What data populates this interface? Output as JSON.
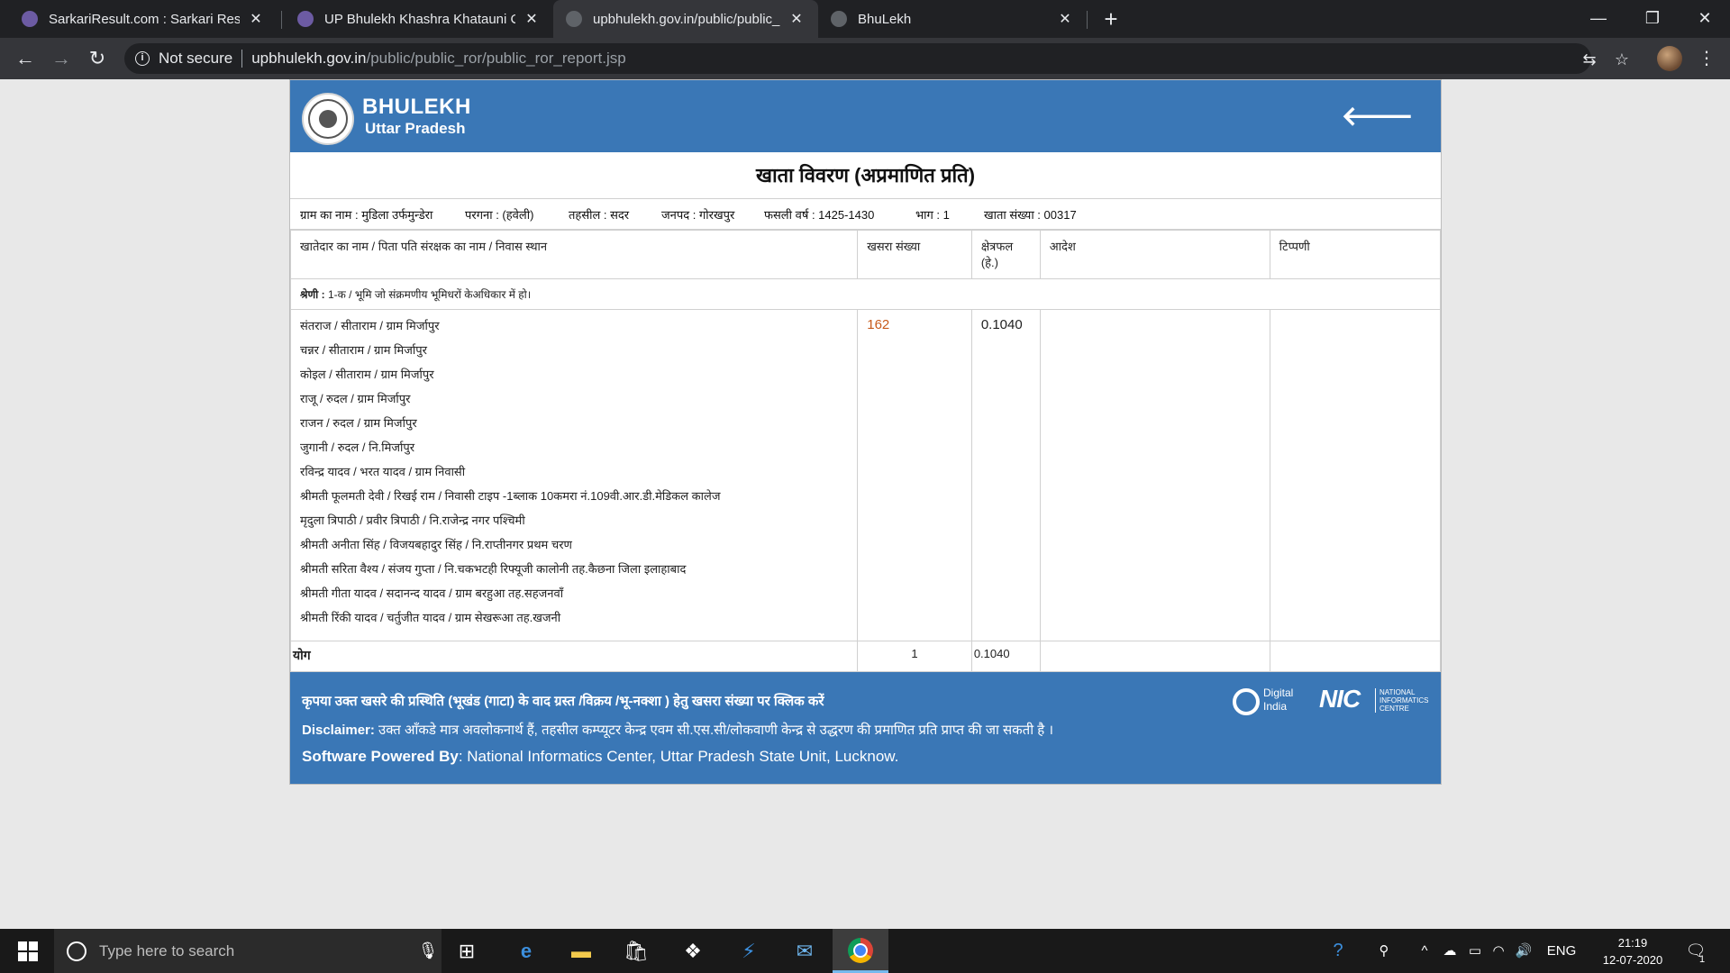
{
  "browser": {
    "tabs": [
      {
        "title": "SarkariResult.com : Sarkari Result",
        "favicon_color": "#6c5ba3",
        "active": false
      },
      {
        "title": "UP Bhulekh Khashra Khatauni Ch",
        "favicon_color": "#6c5ba3",
        "active": false
      },
      {
        "title": "upbhulekh.gov.in/public/public_r",
        "favicon_color": "#5f6368",
        "active": true
      },
      {
        "title": "BhuLekh",
        "favicon_color": "#5f6368",
        "active": false
      }
    ],
    "new_tab_icon": "+",
    "window_controls": {
      "minimize": "—",
      "maximize": "❐",
      "close": "✕"
    },
    "security_label": "Not secure",
    "url_host": "upbhulekh.gov.in",
    "url_path": "/public/public_ror/public_ror_report.jsp"
  },
  "site": {
    "brand_title": "BHULEKH",
    "brand_subtitle": "Uttar Pradesh",
    "header_color": "#3a77b6"
  },
  "report": {
    "title": "खाता विवरण (अप्रमाणित प्रति)",
    "info": {
      "village": "ग्राम का नाम : मुडिला उर्फमुन्डेरा",
      "pargana": "परगना : (हवेली)",
      "tehsil": "तहसील : सदर",
      "district": "जनपद : गोरखपुर",
      "fasli_year": "फसली वर्ष : 1425-1430",
      "bhag": "भाग : 1",
      "khata_no": "खाता संख्या : 00317"
    },
    "columns": {
      "owner": "खातेदार का नाम / पिता पति संरक्षक का नाम / निवास स्थान",
      "khasra": "खसरा संख्या",
      "area": "क्षेत्रफल",
      "area_unit": "(हे.)",
      "order": "आदेश",
      "remark": "टिप्पणी"
    },
    "category_label": "श्रेणी :",
    "category_text": " 1-क / भूमि जो संक्रमणीय भूमिधरों केअधिकार में हो।",
    "owners": [
      "संतराज / सीताराम / ग्राम मिर्जापुर",
      "चन्नर / सीताराम / ग्राम मिर्जापुर",
      "कोइल / सीताराम / ग्राम मिर्जापुर",
      "राजू / रुदल / ग्राम मिर्जापुर",
      "राजन / रुदल / ग्राम मिर्जापुर",
      "जुगानी / रुदल / नि.मिर्जापुर",
      "रविन्द्र यादव / भरत यादव / ग्राम निवासी",
      "श्रीमती फूलमती देवी / रिखई राम / निवासी टाइप -1ब्लाक 10कमरा नं.109वी.आर.डी.मेडिकल कालेज",
      "मृदुला त्रिपाठी / प्रवीर त्रिपाठी / नि.राजेन्द्र नगर पश्चिमी",
      "श्रीमती अनीता सिंह / विजयबहादुर सिंह / नि.राप्तीनगर प्रथम चरण",
      "श्रीमती सरिता वैश्य / संजय गुप्ता / नि.चकभटही रिफ्यूजी कालोनी तह.कैछना जिला इलाहाबाद",
      "श्रीमती गीता यादव / सदानन्द यादव / ग्राम बरहुआ तह.सहजनवॉं",
      "श्रीमती रिंकी यादव / चर्तुजीत यादव / ग्राम सेखरूआ तह.खजनी"
    ],
    "khasra_no": "162",
    "area_value": "0.1040",
    "total_label": "योग",
    "total_count": "1",
    "total_area": "0.1040",
    "link_color": "#c75a1b"
  },
  "footer": {
    "line1": "कृपया उक्त खसरे की प्रस्थिति (भूखंड (गाटा) के वाद ग्रस्त /विक्रय /भू-नक्शा ) हेतु खसरा संख्या पर क्लिक करें",
    "disclaimer_label": "Disclaimer:",
    "disclaimer_text": " उक्त आँकडे मात्र अवलोकनार्थ हैं, तहसील कम्प्यूटर केन्द्र एवम सी.एस.सी/लोकवाणी केन्द्र से उद्धरण की प्रमाणित प्रति प्राप्त की जा सकती है ।",
    "powered_label": "Software Powered By",
    "powered_text": ": National Informatics Center, Uttar Pradesh State Unit, Lucknow.",
    "digital_india_line1": "Digital",
    "digital_india_line2": "India",
    "nic_logo": "NIC",
    "nic_small_line1": "NATIONAL",
    "nic_small_line2": "INFORMATICS",
    "nic_small_line3": "CENTRE"
  },
  "taskbar": {
    "search_placeholder": "Type here to search",
    "lang": "ENG",
    "time": "21:19",
    "date": "12-07-2020",
    "notification_count": "1"
  }
}
